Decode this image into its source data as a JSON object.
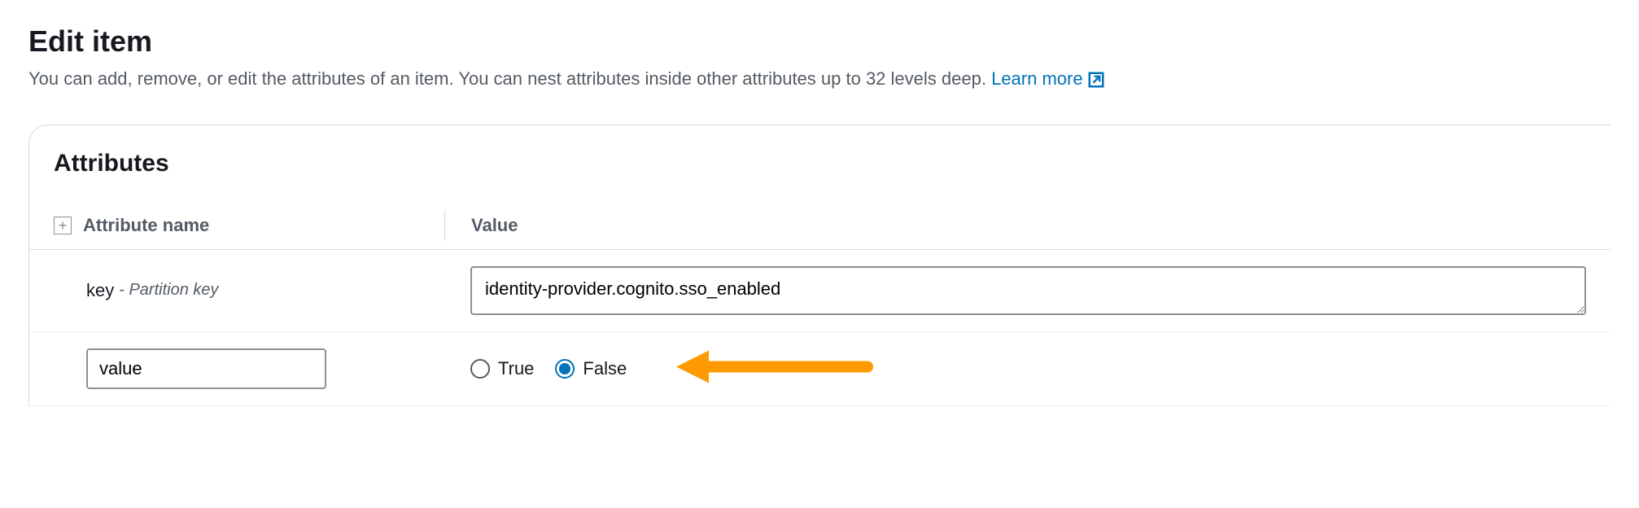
{
  "page": {
    "title": "Edit item",
    "subtitle": "You can add, remove, or edit the attributes of an item. You can nest attributes inside other attributes up to 32 levels deep.",
    "learn_more_label": "Learn more"
  },
  "panel": {
    "title": "Attributes"
  },
  "columns": {
    "name": "Attribute name",
    "value": "Value"
  },
  "rows": [
    {
      "name": "key",
      "hint": "- Partition key",
      "type": "text",
      "value": "identity-provider.cognito.sso_enabled"
    },
    {
      "name": "value",
      "type": "boolean",
      "options": {
        "true": "True",
        "false": "False"
      },
      "selected": "false"
    }
  ],
  "colors": {
    "link": "#0073bb",
    "arrow": "#ff9900"
  }
}
